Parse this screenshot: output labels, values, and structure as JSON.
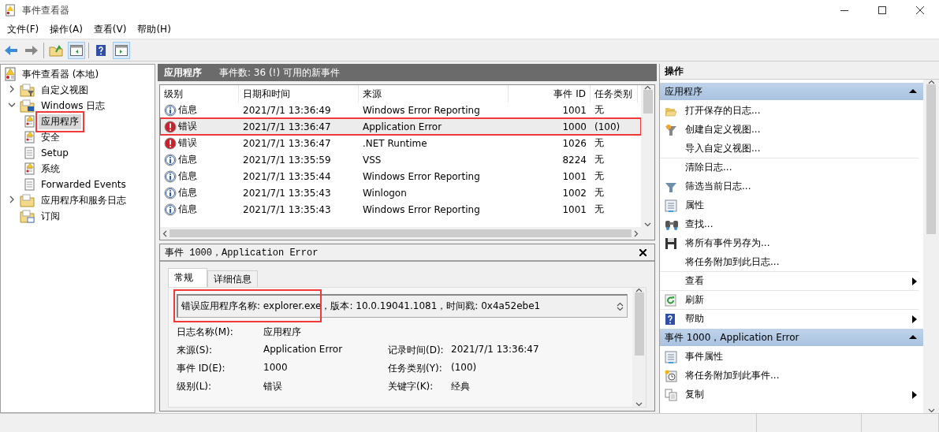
{
  "window": {
    "title": "事件查看器"
  },
  "menu": [
    {
      "label": "文件(F)"
    },
    {
      "label": "操作(A)"
    },
    {
      "label": "查看(V)"
    },
    {
      "label": "帮助(H)"
    }
  ],
  "tree": [
    {
      "label": "事件查看器 (本地)",
      "kind": "root",
      "selected": false,
      "children": [
        {
          "label": "自定义视图",
          "kind": "filter-folder",
          "expanded": false,
          "selected": false
        },
        {
          "label": "Windows 日志",
          "kind": "pc-folder",
          "expanded": true,
          "selected": false,
          "children": [
            {
              "label": "应用程序",
              "kind": "log-alert",
              "selected": true,
              "highlighted": true
            },
            {
              "label": "安全",
              "kind": "log-alert",
              "selected": false,
              "highlighted": false
            },
            {
              "label": "Setup",
              "kind": "log",
              "selected": false,
              "highlighted": false
            },
            {
              "label": "系统",
              "kind": "log-alert",
              "selected": false,
              "highlighted": false
            },
            {
              "label": "Forwarded Events",
              "kind": "log",
              "selected": false,
              "highlighted": false
            }
          ]
        },
        {
          "label": "应用程序和服务日志",
          "kind": "folder",
          "expanded": false,
          "selected": false
        },
        {
          "label": "订阅",
          "kind": "sub-folder",
          "selected": false
        }
      ]
    }
  ],
  "events": {
    "title": "应用程序",
    "summary": "事件数: 36 (!) 可用的新事件",
    "columns": [
      "级别",
      "日期和时间",
      "来源",
      "事件 ID",
      "任务类别"
    ],
    "rows": [
      {
        "kind": "info",
        "severity": "信息",
        "date": "2021/7/1 13:36:49",
        "source": "Windows Error Reporting",
        "event_id": "1001",
        "task": "无",
        "selected": false,
        "highlighted": false
      },
      {
        "kind": "error",
        "severity": "错误",
        "date": "2021/7/1 13:36:47",
        "source": "Application Error",
        "event_id": "1000",
        "task": "(100)",
        "selected": true,
        "highlighted": true
      },
      {
        "kind": "error",
        "severity": "错误",
        "date": "2021/7/1 13:36:47",
        "source": ".NET Runtime",
        "event_id": "1026",
        "task": "无",
        "selected": false,
        "highlighted": false
      },
      {
        "kind": "info",
        "severity": "信息",
        "date": "2021/7/1 13:35:59",
        "source": "VSS",
        "event_id": "8224",
        "task": "无",
        "selected": false,
        "highlighted": false
      },
      {
        "kind": "info",
        "severity": "信息",
        "date": "2021/7/1 13:35:44",
        "source": "Windows Error Reporting",
        "event_id": "1001",
        "task": "无",
        "selected": false,
        "highlighted": false
      },
      {
        "kind": "info",
        "severity": "信息",
        "date": "2021/7/1 13:35:43",
        "source": "Winlogon",
        "event_id": "1002",
        "task": "无",
        "selected": false,
        "highlighted": false
      },
      {
        "kind": "info",
        "severity": "信息",
        "date": "2021/7/1 13:35:43",
        "source": "Windows Error Reporting",
        "event_id": "1001",
        "task": "无",
        "selected": false,
        "highlighted": false
      }
    ]
  },
  "detail": {
    "title": "事件 1000，Application Error",
    "tabs": [
      {
        "label": "常规",
        "selected": true
      },
      {
        "label": "详细信息",
        "selected": false
      }
    ],
    "description": "错误应用程序名称: explorer.exe，版本: 10.0.19041.1081，时间戳: 0x4a52ebe1",
    "description_highlighted": true,
    "rows": [
      {
        "cells": [
          {
            "label": "日志名称(M):",
            "value": "应用程序"
          }
        ]
      },
      {
        "cells": [
          {
            "label": "来源(S):",
            "value": "Application Error"
          },
          {
            "label": "记录时间(D):",
            "value": "2021/7/1 13:36:47"
          }
        ]
      },
      {
        "cells": [
          {
            "label": "事件 ID(E):",
            "value": "1000"
          },
          {
            "label": "任务类别(Y):",
            "value": "(100)"
          }
        ]
      },
      {
        "cells": [
          {
            "label": "级别(L):",
            "value": "错误"
          },
          {
            "label": "关键字(K):",
            "value": "经典"
          }
        ]
      }
    ]
  },
  "actions": {
    "title": "操作",
    "sections": [
      {
        "title": "应用程序",
        "expanded": true,
        "items": [
          {
            "label": "打开保存的日志...",
            "kind": "open",
            "submenu": false,
            "separator_after": false
          },
          {
            "label": "创建自定义视图...",
            "kind": "create-filter",
            "submenu": false,
            "separator_after": false
          },
          {
            "label": "导入自定义视图...",
            "kind": "none",
            "submenu": false,
            "separator_after": true
          },
          {
            "label": "清除日志...",
            "kind": "none",
            "submenu": false,
            "separator_after": false
          },
          {
            "label": "筛选当前日志...",
            "kind": "filter",
            "submenu": false,
            "separator_after": false
          },
          {
            "label": "属性",
            "kind": "properties",
            "submenu": false,
            "separator_after": false
          },
          {
            "label": "查找...",
            "kind": "find",
            "submenu": false,
            "separator_after": false
          },
          {
            "label": "将所有事件另存为...",
            "kind": "save",
            "submenu": false,
            "separator_after": false
          },
          {
            "label": "将任务附加到此日志...",
            "kind": "none",
            "submenu": false,
            "separator_after": true
          },
          {
            "label": "查看",
            "kind": "none",
            "submenu": true,
            "separator_after": true
          },
          {
            "label": "刷新",
            "kind": "refresh",
            "submenu": false,
            "separator_after": true
          },
          {
            "label": "帮助",
            "kind": "help",
            "submenu": true,
            "separator_after": false
          }
        ]
      },
      {
        "title": "事件 1000，Application Error",
        "expanded": true,
        "items": [
          {
            "label": "事件属性",
            "kind": "properties",
            "submenu": false,
            "separator_after": false
          },
          {
            "label": "将任务附加到此事件...",
            "kind": "task",
            "submenu": false,
            "separator_after": false
          },
          {
            "label": "复制",
            "kind": "copy",
            "submenu": true,
            "separator_after": false
          }
        ]
      }
    ]
  }
}
